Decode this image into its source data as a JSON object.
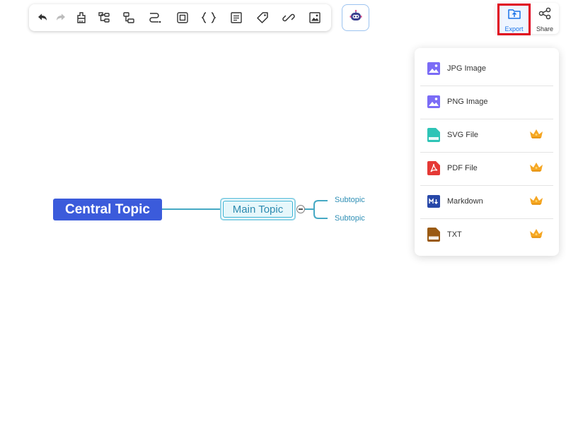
{
  "toolbar": {
    "icons": [
      "undo-icon",
      "redo-icon",
      "format-painter-icon",
      "topic-icon",
      "subtopic-icon",
      "relationship-icon",
      "boundary-icon",
      "summary-icon",
      "note-icon",
      "tag-icon",
      "link-icon",
      "image-icon"
    ]
  },
  "ai_button": {
    "icon": "robot-icon"
  },
  "header": {
    "export_label": "Export",
    "share_label": "Share"
  },
  "export_menu": {
    "items": [
      {
        "label": "JPG Image",
        "icon": "jpg-file-icon",
        "premium": false,
        "color": "#7b6cf6"
      },
      {
        "label": "PNG Image",
        "icon": "png-file-icon",
        "premium": false,
        "color": "#7b6cf6"
      },
      {
        "label": "SVG File",
        "icon": "svg-file-icon",
        "premium": true,
        "color": "#2ec4b6"
      },
      {
        "label": "PDF File",
        "icon": "pdf-file-icon",
        "premium": true,
        "color": "#e53935"
      },
      {
        "label": "Markdown",
        "icon": "markdown-file-icon",
        "premium": true,
        "color": "#2747a8"
      },
      {
        "label": "TXT",
        "icon": "txt-file-icon",
        "premium": true,
        "color": "#9a5a12"
      }
    ]
  },
  "mindmap": {
    "central": "Central Topic",
    "main": "Main Topic",
    "subtopics": [
      "Subtopic",
      "Subtopic"
    ]
  },
  "colors": {
    "central_bg": "#3b5bdb",
    "main_border": "#35b0d2",
    "connector": "#46a9c4",
    "export_highlight": "#e0001b",
    "export_text": "#1a73e8"
  }
}
